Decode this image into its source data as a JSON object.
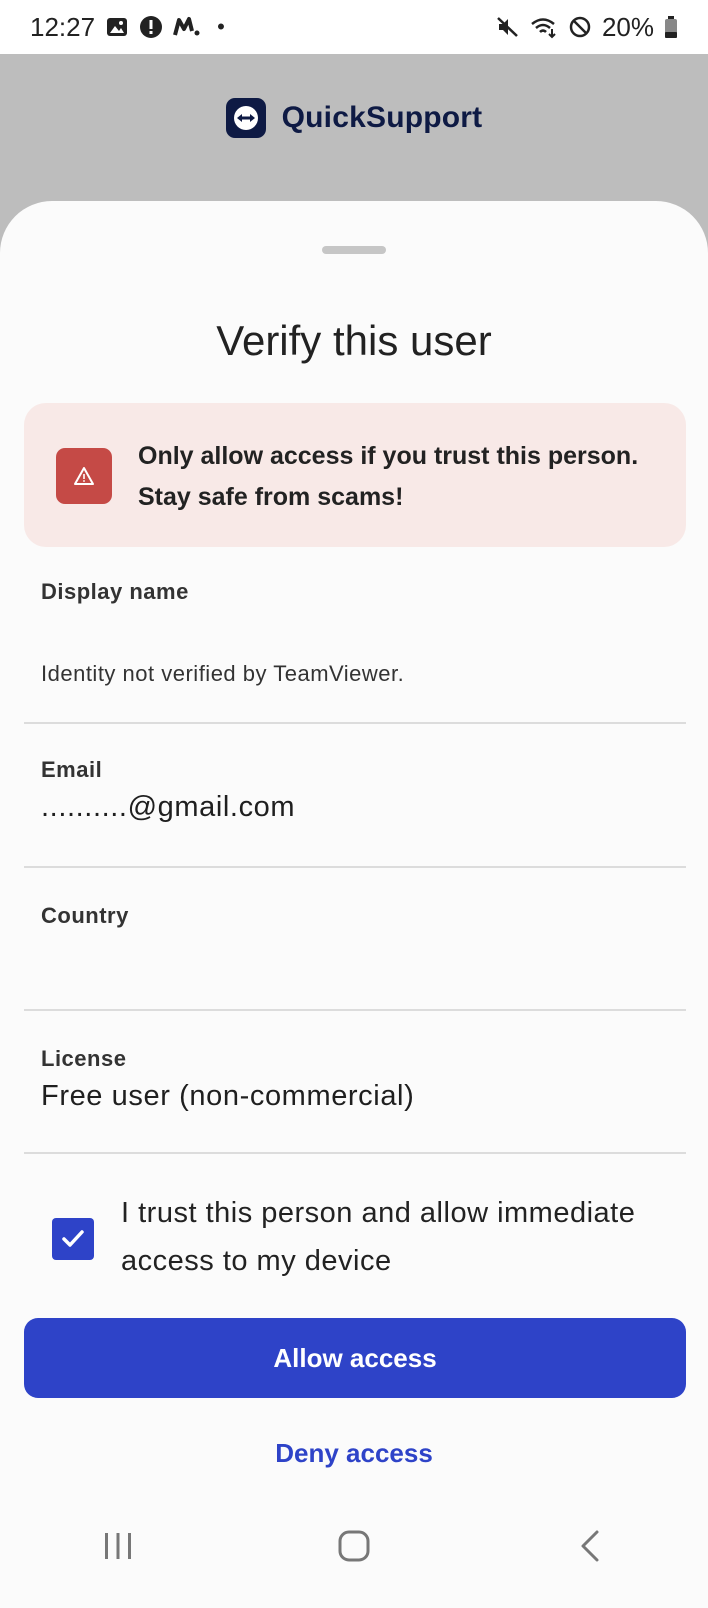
{
  "status_bar": {
    "time": "12:27",
    "left_icons": [
      "gallery-icon",
      "alert-circle-icon",
      "messenger-icon",
      "dot-icon"
    ],
    "right_icons": [
      "mute-icon",
      "wifi-icon",
      "do-not-disturb-icon"
    ],
    "battery_percent": "20%"
  },
  "app_bar": {
    "app_name": "QuickSupport",
    "logo_icon": "teamviewer-logo-icon",
    "brand_color": "#0e1a44"
  },
  "sheet": {
    "title": "Verify this user",
    "warning": {
      "icon": "warning-triangle-icon",
      "text": "Only allow access if you trust this person. Stay safe from scams!",
      "background_color": "#f8e9e7",
      "icon_color": "#c54a46"
    },
    "fields": {
      "display_name": {
        "label": "Display name",
        "note": "Identity not verified by TeamViewer."
      },
      "email": {
        "label": "Email",
        "value": "..........@gmail.com"
      },
      "country": {
        "label": "Country",
        "value": ""
      },
      "license": {
        "label": "License",
        "value": "Free user (non-commercial)"
      }
    },
    "trust_checkbox": {
      "checked": true,
      "label": "I trust this person and allow immediate access to my device"
    },
    "allow_button": "Allow access",
    "deny_button": "Deny access",
    "accent_color": "#2e43c8"
  },
  "nav_bar": {
    "icons": [
      "recents-icon",
      "home-icon",
      "back-icon"
    ]
  }
}
